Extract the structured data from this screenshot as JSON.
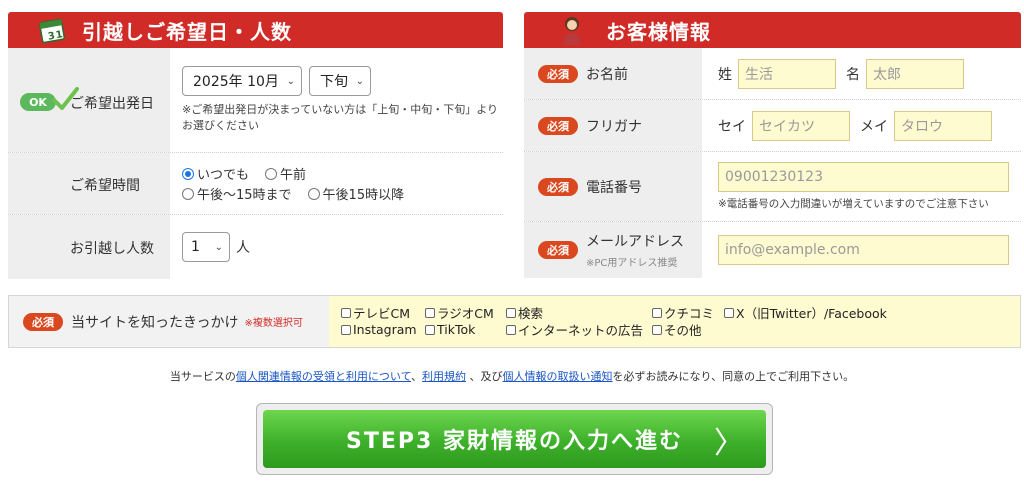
{
  "left_panel": {
    "title": "引越しご希望日・人数",
    "rows": {
      "date": {
        "ok_badge": "OK",
        "label": "ご希望出発日",
        "month_select": "2025年 10月",
        "period_select": "下旬",
        "note": "※ご希望出発日が決まっていない方は「上旬・中旬・下旬」よりお選びください"
      },
      "time": {
        "label": "ご希望時間",
        "options": [
          "いつでも",
          "午前",
          "午後〜15時まで",
          "午後15時以降"
        ],
        "selected": "いつでも"
      },
      "people": {
        "label": "お引越し人数",
        "count_select": "1",
        "unit": "人"
      }
    }
  },
  "right_panel": {
    "title": "お客様情報",
    "required_badge": "必須",
    "rows": {
      "name": {
        "label": "お名前",
        "sei_label": "姓",
        "sei_placeholder": "生活",
        "mei_label": "名",
        "mei_placeholder": "太郎"
      },
      "furigana": {
        "label": "フリガナ",
        "sei_label": "セイ",
        "sei_placeholder": "セイカツ",
        "mei_label": "メイ",
        "mei_placeholder": "タロウ"
      },
      "phone": {
        "label": "電話番号",
        "placeholder": "09001230123",
        "note": "※電話番号の入力間違いが増えていますのでご注意下さい"
      },
      "email": {
        "label": "メールアドレス",
        "sub_label": "※PC用アドレス推奨",
        "placeholder": "info@example.com"
      }
    }
  },
  "source": {
    "required_badge": "必須",
    "label": "当サイトを知ったきっかけ",
    "sub_label": "※複数選択可",
    "options_row1": [
      "テレビCM",
      "ラジオCM",
      "検索",
      "クチコミ",
      "X（旧Twitter）/Facebook"
    ],
    "options_row2": [
      "Instagram",
      "TikTok",
      "インターネットの広告",
      "その他"
    ]
  },
  "notice": {
    "prefix": "当サービスの",
    "link1": "個人関連情報の受領と利用について",
    "sep1": "、",
    "link2": "利用規約",
    "sep2": " 、及び",
    "link3": "個人情報の取扱い通知",
    "suffix": "を必ずお読みになり、同意の上でご利用下さい。"
  },
  "cta": {
    "label": "STEP3 家財情報の入力へ進む",
    "arrow": "〉"
  },
  "colors": {
    "header_red": "#d12b28",
    "badge_orange": "#d9481e",
    "ok_green": "#5cb85c",
    "input_yellow": "#fffbd1",
    "cta_green": "#3db02a"
  }
}
